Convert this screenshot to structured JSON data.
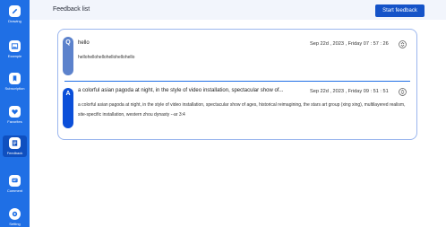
{
  "nav": [
    {
      "label": "Drawing",
      "icon": "pencil-icon"
    },
    {
      "label": "Example",
      "icon": "image-icon"
    },
    {
      "label": "Subscription",
      "icon": "bookmark-icon"
    },
    {
      "label": "Favorites",
      "icon": "heart-icon"
    },
    {
      "label": "Feedback",
      "icon": "feedback-icon"
    },
    {
      "label": "Comment",
      "icon": "comment-icon"
    },
    {
      "label": "Setting",
      "icon": "gear-icon"
    }
  ],
  "active_nav": "Feedback",
  "header": {
    "title": "Feedback list",
    "start_button": "Start feedback"
  },
  "question": {
    "badge": "Q",
    "title": "hello",
    "time": "Sep 22d , 2023 , Friday  07 : 57 : 26",
    "body": "hellohellohellohellohellohello"
  },
  "answer": {
    "badge": "A",
    "title": "a colorful asian pagoda at night, in the style of video installation, spectacular show of...",
    "time": "Sep 22d , 2023 , Friday  09 : 51 : 51",
    "body": "a colorful asian pagoda at night, in the style of video installation, spectacular show of ages, historical reimagining, the stars art group (xing xing), multilayered realism, site-specific installation, western zhou dynasty --ar 3:4"
  },
  "colors": {
    "primary": "#1f6fe5",
    "button": "#1553c8",
    "badge_q": "#5c82cc",
    "badge_a": "#0b4fd9"
  }
}
